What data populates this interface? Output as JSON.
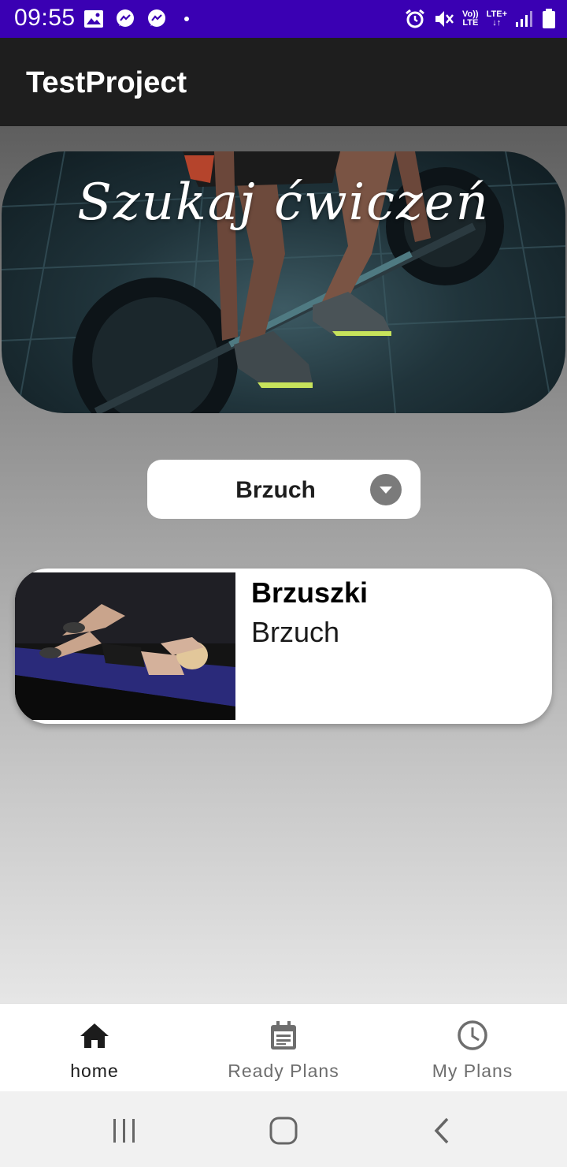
{
  "status_bar": {
    "time": "09:55",
    "network_top": "Vo))",
    "network_bottom": "LTE",
    "lte_label": "LTE+",
    "icons": [
      "image-icon",
      "messenger-icon",
      "messenger-icon",
      "dot-icon",
      "alarm-icon",
      "mute-icon",
      "volte-icon",
      "lte-icon",
      "signal-icon",
      "battery-icon"
    ]
  },
  "app_bar": {
    "title": "TestProject"
  },
  "hero": {
    "title": "Szukaj ćwiczeń"
  },
  "dropdown": {
    "selected": "Brzuch"
  },
  "exercises": [
    {
      "name": "Brzuszki",
      "category": "Brzuch"
    }
  ],
  "bottom_nav": {
    "items": [
      {
        "label": "home",
        "icon": "home-icon",
        "active": true
      },
      {
        "label": "Ready Plans",
        "icon": "calendar-icon",
        "active": false
      },
      {
        "label": "My Plans",
        "icon": "clock-icon",
        "active": false
      }
    ]
  },
  "system_nav": {
    "icons": [
      "recent-apps-icon",
      "home-button-icon",
      "back-icon"
    ]
  },
  "colors": {
    "status_bar": "#3a00b3",
    "app_bar": "#1e1e1e",
    "active_nav": "#1c1c1c",
    "inactive_nav": "#6e6e6e"
  }
}
